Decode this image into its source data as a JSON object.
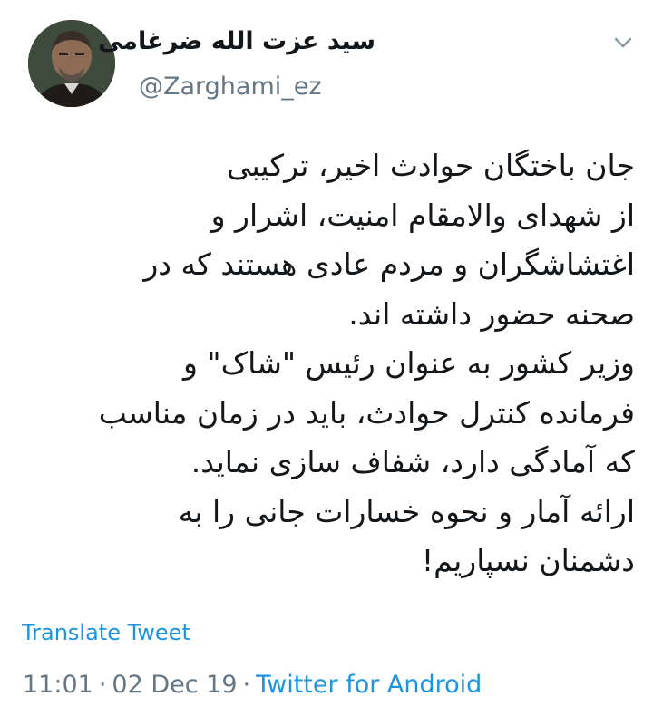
{
  "user": {
    "display_name": "سید عزت الله ضرغامی",
    "handle": "@Zarghami_ez"
  },
  "icons": {
    "avatar": "profile-photo",
    "caret": "chevron-down-icon"
  },
  "tweet": {
    "lines": [
      "جان باختگان حوادث اخیر، ترکیبی",
      "از شهدای والامقام امنیت، اشرار و",
      "اغتشاشگران و مردم عادی هستند که در",
      "صحنه حضور داشته اند.",
      "وزیر کشور به عنوان رئیس \"شاک\" و",
      "فرمانده کنترل حوادث، باید در زمان مناسب",
      "که آمادگی دارد، شفاف سازی نماید.",
      "ارائه آمار و نحوه خسارات جانی را به",
      "دشمنان نسپاریم!"
    ]
  },
  "translate_label": "Translate Tweet",
  "meta": {
    "time": "11:01",
    "date": "02 Dec 19",
    "separator": "·",
    "source": "Twitter for Android"
  },
  "colors": {
    "link": "#1b95e0",
    "secondary": "#657786",
    "text": "#14171a"
  }
}
